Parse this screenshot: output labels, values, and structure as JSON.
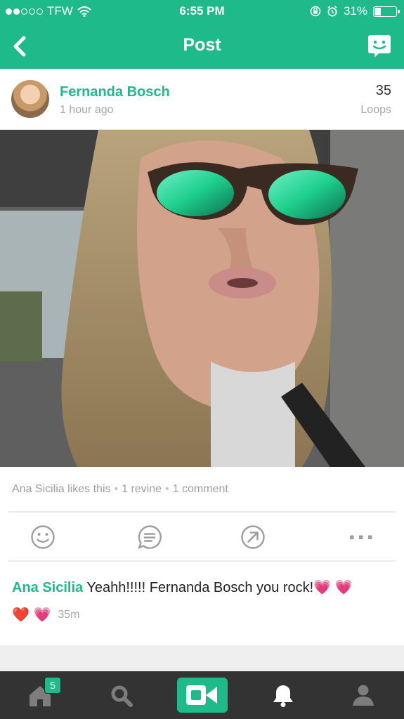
{
  "status_bar": {
    "carrier": "TFW",
    "time": "6:55 PM",
    "battery": "31%",
    "battery_level": 0.31,
    "signal_filled": 2,
    "signal_total": 5
  },
  "nav": {
    "title": "Post",
    "back_icon": "chevron-left-icon",
    "right_icon": "chat-smiley-icon"
  },
  "post": {
    "author": "Fernanda Bosch",
    "time": "1 hour ago",
    "loops_count": "35",
    "loops_label": "Loops"
  },
  "engagement": {
    "likes": "Ana Sicilia likes this",
    "revines": "1 revine",
    "comments": "1 comment",
    "separator": "•"
  },
  "actions": [
    "like-smiley-icon",
    "comment-icon",
    "revine-share-icon",
    "more-icon"
  ],
  "comment": {
    "user": "Ana Sicilia",
    "text": "Yeahh!!!!! Fernanda Bosch you rock!",
    "emoji_after_text": "💗 💗",
    "emoji_line": "❤️ 💗",
    "time": "35m"
  },
  "tab_bar": {
    "home_badge": "5",
    "tabs": [
      "home-icon",
      "search-icon",
      "camera-icon",
      "bell-icon",
      "profile-icon"
    ]
  },
  "colors": {
    "brand": "#1fba8a",
    "tab_bar": "#333333"
  }
}
